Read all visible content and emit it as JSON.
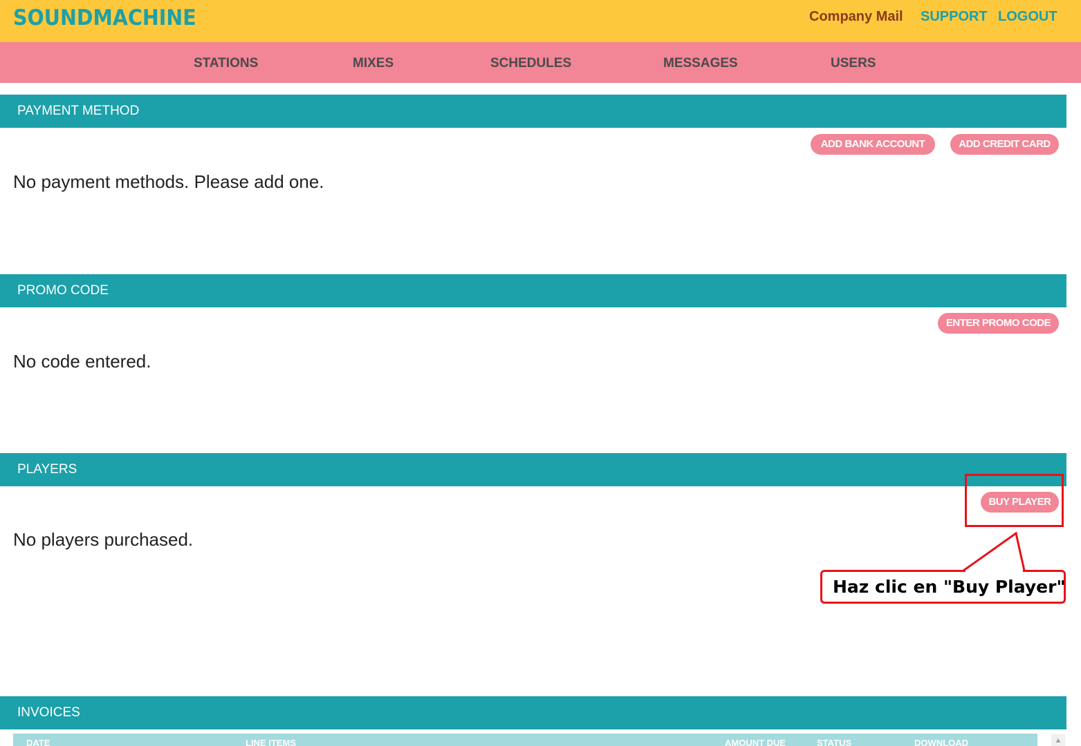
{
  "header": {
    "logo": "SOUNDMACHINE",
    "company_mail": "Company Mail",
    "support": "SUPPORT",
    "logout": "LOGOUT"
  },
  "nav": {
    "stations": "STATIONS",
    "mixes": "MIXES",
    "schedules": "SCHEDULES",
    "messages": "MESSAGES",
    "users": "USERS"
  },
  "payment": {
    "title": "PAYMENT METHOD",
    "add_bank": "ADD BANK ACCOUNT",
    "add_card": "ADD CREDIT CARD",
    "empty": "No payment methods. Please add one."
  },
  "promo": {
    "title": "PROMO CODE",
    "enter": "ENTER PROMO CODE",
    "empty": "No code entered."
  },
  "players": {
    "title": "PLAYERS",
    "buy": "BUY PLAYER",
    "empty": "No players purchased."
  },
  "invoices": {
    "title": "INVOICES",
    "columns": {
      "date": "DATE",
      "line_items": "LINE ITEMS",
      "amount_due": "AMOUNT DUE",
      "status": "STATUS",
      "download": "DOWNLOAD"
    }
  },
  "annotation": {
    "text": "Haz clic en \"Buy Player\""
  },
  "colors": {
    "topbar": "#fdc83c",
    "navbar": "#f28596",
    "teal": "#1ca0a9",
    "pill": "#f28596",
    "callout": "#e8101a"
  }
}
